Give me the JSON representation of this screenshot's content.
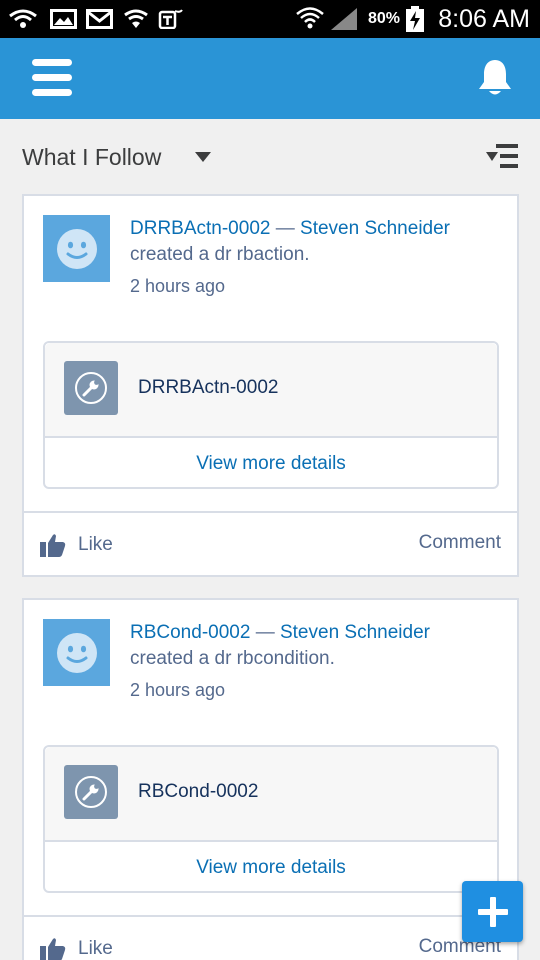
{
  "status_bar": {
    "battery": "80%",
    "time": "8:06 AM",
    "icons": [
      "wifi-calling-icon",
      "gallery-icon",
      "gmail-icon",
      "wifi-notification-icon",
      "tmobile-icon",
      "wifi-icon",
      "signal-icon",
      "battery-charging-icon"
    ]
  },
  "header": {
    "menu_icon": "hamburger-menu-icon",
    "notifications_icon": "bell-icon",
    "accent": "#2a94d6"
  },
  "feed": {
    "title": "What I Follow",
    "sort_icon": "sort-icon"
  },
  "posts": [
    {
      "record_link": "DRRBActn-0002",
      "separator": " — ",
      "author": "Steven Schneider",
      "action": "created a dr rbaction.",
      "time": "2 hours ago",
      "record_name": "DRRBActn-0002",
      "view_more": "View more details",
      "like": "Like",
      "comment": "Comment"
    },
    {
      "record_link": "RBCond-0002",
      "separator": " — ",
      "author": "Steven Schneider",
      "action": "created a dr rbcondition.",
      "time": "2 hours ago",
      "record_name": "RBCond-0002",
      "view_more": "View more details",
      "like": "Like",
      "comment": "Comment"
    }
  ],
  "fab": {
    "icon": "plus-icon",
    "color": "#1f8fe1"
  }
}
